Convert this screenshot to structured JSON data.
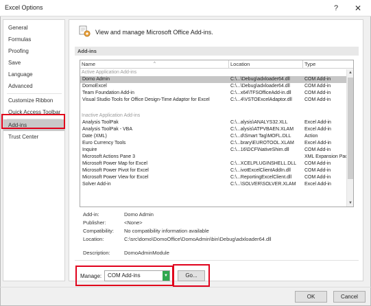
{
  "window": {
    "title": "Excel Options",
    "help_label": "?",
    "close_label": "✕"
  },
  "sidebar": {
    "items": [
      {
        "label": "General"
      },
      {
        "label": "Formulas"
      },
      {
        "label": "Proofing"
      },
      {
        "label": "Save"
      },
      {
        "label": "Language"
      },
      {
        "label": "Advanced"
      },
      {
        "label": "Customize Ribbon"
      },
      {
        "label": "Quick Access Toolbar"
      },
      {
        "label": "Add-ins",
        "active": true
      },
      {
        "label": "Trust Center"
      }
    ]
  },
  "main": {
    "header_text": "View and manage Microsoft Office Add-ins.",
    "section_title": "Add-ins",
    "header_icon": "gear-puzzle-icon"
  },
  "table": {
    "columns": [
      "Name",
      "Location",
      "Type"
    ],
    "sort_indicator": "^",
    "groups": [
      {
        "label": "Active Application Add-ins",
        "rows": [
          {
            "name": "Domo Admin",
            "location": "C:\\...\\Debug\\adxloader64.dll",
            "type": "COM Add-in",
            "selected": true
          },
          {
            "name": "DomoExcel",
            "location": "C:\\...\\Debug\\adxloader64.dll",
            "type": "COM Add-in"
          },
          {
            "name": "Team Foundation Add-in",
            "location": "C:\\...x64\\TFSOfficeAdd-in.dll",
            "type": "COM Add-in"
          },
          {
            "name": "Visual Studio Tools for Office Design-Time Adaptor for Excel",
            "location": "C:\\...4\\VSTOExcelAdaptor.dll",
            "type": "COM Add-in"
          }
        ]
      },
      {
        "label": "Inactive Application Add-ins",
        "rows": [
          {
            "name": "Analysis ToolPak",
            "location": "C:\\...alysis\\ANALYS32.XLL",
            "type": "Excel Add-in"
          },
          {
            "name": "Analysis ToolPak - VBA",
            "location": "C:\\...alysis\\ATPVBAEN.XLAM",
            "type": "Excel Add-in"
          },
          {
            "name": "Date (XML)",
            "location": "C:\\...d\\Smart Tag\\MOFL.DLL",
            "type": "Action"
          },
          {
            "name": "Euro Currency Tools",
            "location": "C:\\...brary\\EUROTOOL.XLAM",
            "type": "Excel Add-in"
          },
          {
            "name": "Inquire",
            "location": "C:\\...16\\DCF\\NativeShim.dll",
            "type": "COM Add-in"
          },
          {
            "name": "Microsoft Actions Pane 3",
            "location": "",
            "type": "XML Expansion Pack"
          },
          {
            "name": "Microsoft Power Map for Excel",
            "location": "C:\\...XCELPLUGINSHELL.DLL",
            "type": "COM Add-in"
          },
          {
            "name": "Microsoft Power Pivot for Excel",
            "location": "C:\\...ivotExcelClientAddIn.dll",
            "type": "COM Add-in"
          },
          {
            "name": "Microsoft Power View for Excel",
            "location": "C:\\...ReportingExcelClient.dll",
            "type": "COM Add-in"
          },
          {
            "name": "Solver Add-in",
            "location": "C:\\...\\SOLVER\\SOLVER.XLAM",
            "type": "Excel Add-in"
          }
        ]
      }
    ]
  },
  "details": [
    {
      "label": "Add-in:",
      "value": "Domo Admin"
    },
    {
      "label": "Publisher:",
      "value": "<None>"
    },
    {
      "label": "Compatibility:",
      "value": "No compatibility information available"
    },
    {
      "label": "Location:",
      "value": "C:\\src\\domo\\DomoOffice\\DomoAdmin\\bin\\Debug\\adxloader64.dll"
    },
    {
      "label": "Description:",
      "value": "DomoAdminModule"
    }
  ],
  "manage": {
    "label": "Manage:",
    "selected": "COM Add-ins",
    "go_label": "Go..."
  },
  "footer": {
    "ok_label": "OK",
    "cancel_label": "Cancel"
  },
  "colors": {
    "highlight": "#e0001b",
    "dropdown_arrow": "#2fa84f",
    "selected_row": "#c6c6c6"
  }
}
